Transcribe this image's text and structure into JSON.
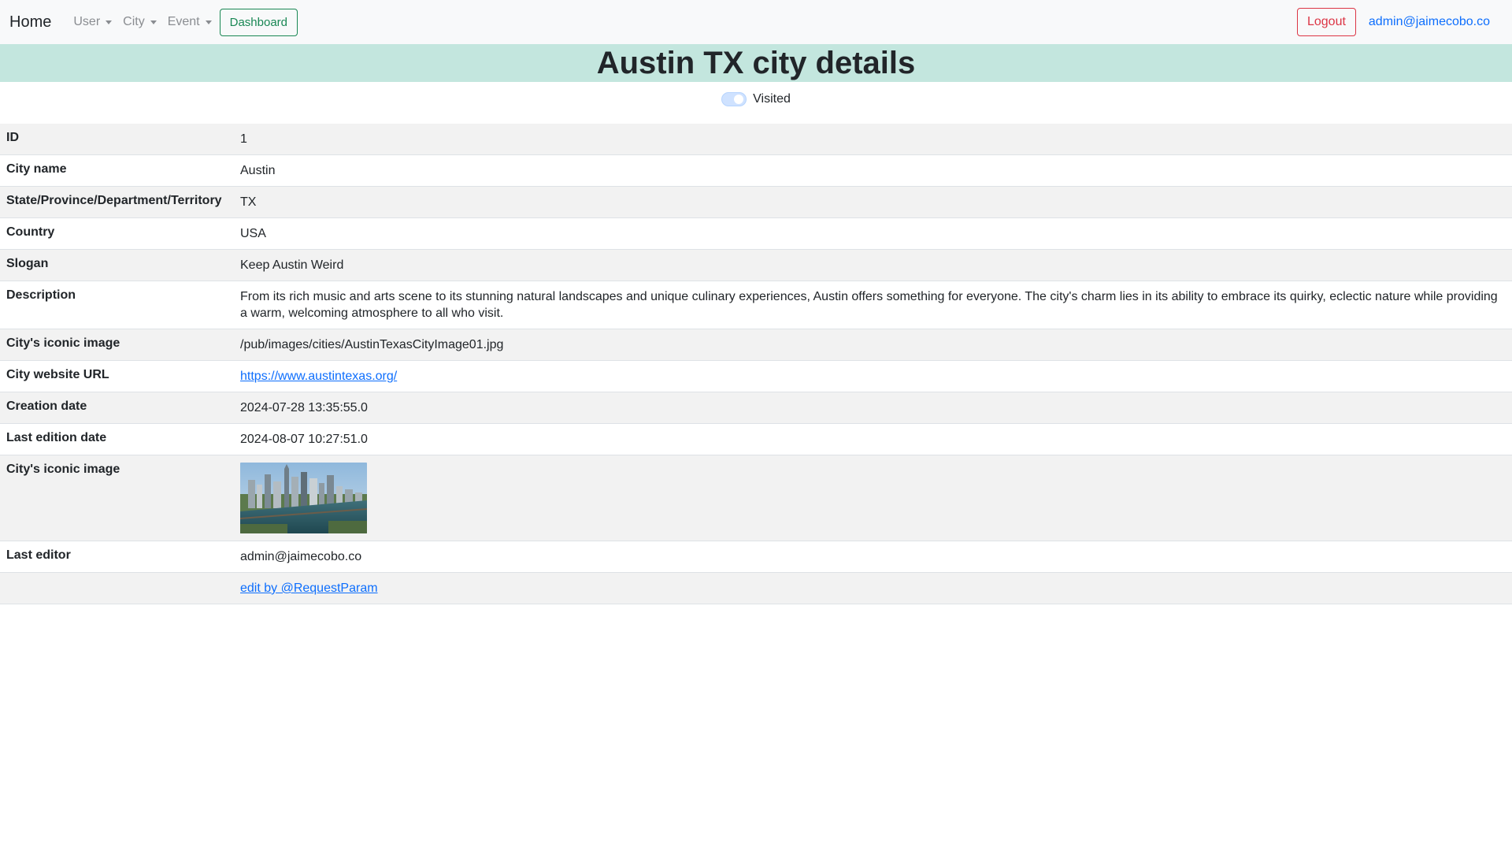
{
  "nav": {
    "brand": "Home",
    "menu": [
      {
        "label": "User"
      },
      {
        "label": "City"
      },
      {
        "label": "Event"
      }
    ],
    "dashboard_label": "Dashboard",
    "logout_label": "Logout",
    "user_email": "admin@jaimecobo.co"
  },
  "page": {
    "title": "Austin TX city details",
    "visited_label": "Visited",
    "visited": true
  },
  "details": {
    "rows": [
      {
        "label": "ID",
        "value": "1"
      },
      {
        "label": "City name",
        "value": "Austin"
      },
      {
        "label": "State/Province/Department/Territory",
        "value": "TX"
      },
      {
        "label": "Country",
        "value": "USA"
      },
      {
        "label": "Slogan",
        "value": "Keep Austin Weird"
      },
      {
        "label": "Description",
        "value": "From its rich music and arts scene to its stunning natural landscapes and unique culinary experiences, Austin offers something for everyone. The city's charm lies in its ability to embrace its quirky, eclectic nature while providing a warm, welcoming atmosphere to all who visit."
      },
      {
        "label": "City's iconic image",
        "value": "/pub/images/cities/AustinTexasCityImage01.jpg"
      },
      {
        "label": "City website URL",
        "value": "https://www.austintexas.org/"
      },
      {
        "label": "Creation date",
        "value": "2024-07-28 13:35:55.0"
      },
      {
        "label": "Last edition date",
        "value": "2024-08-07 10:27:51.0"
      },
      {
        "label": "City's iconic image",
        "value": ""
      },
      {
        "label": "Last editor",
        "value": "admin@jaimecobo.co"
      },
      {
        "label": "",
        "value": "edit by @RequestParam"
      }
    ]
  },
  "colors": {
    "banner_bg": "#c3e6de",
    "dashboard": "#198754",
    "logout": "#dc3545",
    "link": "#0d6efd"
  }
}
